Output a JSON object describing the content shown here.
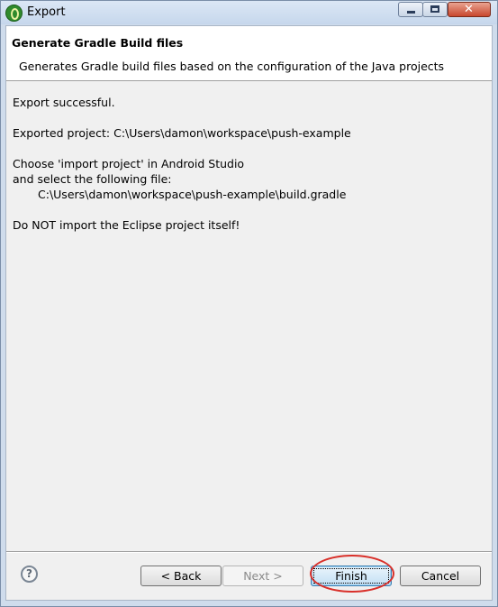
{
  "window": {
    "title": "Export",
    "app_icon": "eclipse-icon"
  },
  "header": {
    "title": "Generate Gradle Build files",
    "description": "Generates Gradle build files based on the configuration of the Java projects"
  },
  "body": {
    "lines": [
      "Export successful.",
      "Exported project: C:\\Users\\damon\\workspace\\push-example",
      "Choose 'import project' in Android Studio",
      "and select the following file:",
      "C:\\Users\\damon\\workspace\\push-example\\build.gradle",
      "Do NOT import the Eclipse project itself!"
    ]
  },
  "buttons": {
    "help": "?",
    "back": "< Back",
    "next": "Next >",
    "finish": "Finish",
    "cancel": "Cancel"
  },
  "colors": {
    "highlight": "#d9302a",
    "titlebar": "#cfdcec",
    "close_button": "#c8472d"
  }
}
